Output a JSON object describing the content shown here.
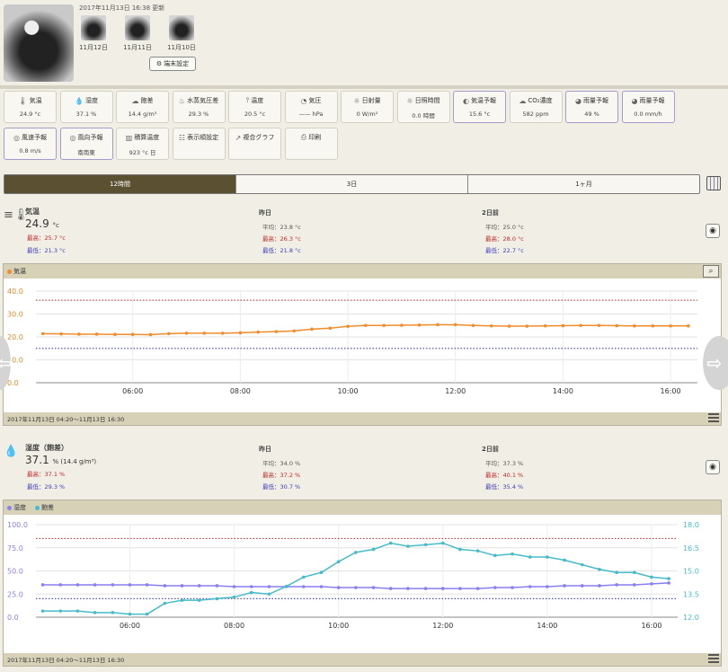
{
  "header": {
    "updated": "2017年11月13日 16:38 更新",
    "thumbs": [
      {
        "date": "11月12日"
      },
      {
        "date": "11月11日"
      },
      {
        "date": "11月10日"
      }
    ],
    "terminal_settings": "端末設定"
  },
  "tiles": [
    {
      "title": "気温",
      "value": "24.9 °c",
      "icon": "thermometer-icon",
      "purple": false
    },
    {
      "title": "湿度",
      "value": "37.1 %",
      "icon": "droplets-icon",
      "purple": false
    },
    {
      "title": "飽差",
      "value": "14.4 g/m³",
      "icon": "cloud-icon",
      "purple": false
    },
    {
      "title": "水蒸気圧差",
      "value": "29.3 %",
      "icon": "vapor-icon",
      "purple": false
    },
    {
      "title": "温度",
      "value": "20.5 °c",
      "icon": "soil-temp-icon",
      "purple": false
    },
    {
      "title": "気圧",
      "value": "—— hPa",
      "icon": "gauge-icon",
      "purple": false
    },
    {
      "title": "日射量",
      "value": "0 W/m²",
      "icon": "sun-icon",
      "purple": false
    },
    {
      "title": "日照時間",
      "value": "0.0 時間",
      "icon": "sun-time-icon",
      "purple": false
    },
    {
      "title": "気温予報",
      "value": "15.6 °c",
      "icon": "forecast-temp-icon",
      "purple": true
    },
    {
      "title": "CO₂濃度",
      "value": "582 ppm",
      "icon": "co2-icon",
      "purple": false
    },
    {
      "title": "雨量予報",
      "value": "49 %",
      "icon": "rain-icon",
      "purple": true
    },
    {
      "title": "雨量予報",
      "value": "0.0 mm/h",
      "icon": "rain-amount-icon",
      "purple": true
    },
    {
      "title": "風速予報",
      "value": "0.8 m/s",
      "icon": "wind-icon",
      "purple": true
    },
    {
      "title": "風向予報",
      "value": "南南東",
      "icon": "wind-direction-icon",
      "purple": true
    },
    {
      "title": "積算温度",
      "value": "923 °c 日",
      "icon": "accumulated-temp-icon",
      "purple": false
    },
    {
      "title": "表示順設定",
      "value": "",
      "icon": "order-settings-icon",
      "purple": false
    },
    {
      "title": "複合グラフ",
      "value": "",
      "icon": "composite-graph-icon",
      "purple": false
    },
    {
      "title": "印刷",
      "value": "",
      "icon": "print-icon",
      "purple": false
    }
  ],
  "tabs": [
    "12時間",
    "3日",
    "1ヶ月"
  ],
  "temp": {
    "name": "気温",
    "main": "24.9",
    "unit": "°c",
    "today_max": "最高：25.7 °c",
    "today_min": "最低：21.3 °c",
    "yesterday_label": "昨日",
    "y_avg": "平均：23.8 °c",
    "y_max": "最高：26.3 °c",
    "y_min": "最低：21.8 °c",
    "two_days_label": "2日前",
    "d2_avg": "平均：25.0 °c",
    "d2_max": "最高：28.0 °c",
    "d2_min": "最低：22.7 °c",
    "legend": "気温",
    "footer": "2017年11月13日 04:20～11月13日 16:30"
  },
  "humid": {
    "name": "湿度（飽差）",
    "main": "37.1",
    "unit": "% (14.4 g/m³)",
    "today_max": "最高：37.1 %",
    "today_min": "最低：29.3 %",
    "yesterday_label": "昨日",
    "y_avg": "平均：34.0 %",
    "y_max": "最高：37.2 %",
    "y_min": "最低：30.7 %",
    "two_days_label": "2日前",
    "d2_avg": "平均：37.3 %",
    "d2_max": "最高：40.1 %",
    "d2_min": "最低：35.4 %",
    "legend1": "湿度",
    "legend2": "飽差",
    "footer": "2017年11月13日 04:20～11月13日 16:30"
  },
  "chart_data": [
    {
      "type": "line",
      "title": "気温",
      "x": [
        4.33,
        4.67,
        5.0,
        5.33,
        5.67,
        6.0,
        6.33,
        6.67,
        7.0,
        7.33,
        7.67,
        8.0,
        8.33,
        8.67,
        9.0,
        9.33,
        9.67,
        10.0,
        10.33,
        10.67,
        11.0,
        11.33,
        11.67,
        12.0,
        12.33,
        12.67,
        13.0,
        13.33,
        13.67,
        14.0,
        14.33,
        14.67,
        15.0,
        15.33,
        15.67,
        16.0,
        16.33
      ],
      "series": [
        {
          "name": "気温",
          "color": "#f08c2c",
          "values": [
            21.4,
            21.3,
            21.2,
            21.2,
            21.1,
            21.1,
            21.0,
            21.4,
            21.6,
            21.6,
            21.6,
            21.8,
            22.1,
            22.3,
            22.6,
            23.4,
            23.8,
            24.6,
            25.0,
            25.0,
            25.1,
            25.2,
            25.3,
            25.3,
            25.0,
            24.8,
            24.7,
            24.7,
            24.8,
            24.9,
            25.0,
            25.0,
            24.9,
            24.8,
            24.8,
            24.8,
            24.8
          ]
        }
      ],
      "xticks": [
        "06:00",
        "08:00",
        "10:00",
        "12:00",
        "14:00",
        "16:00"
      ],
      "xtick_values": [
        6,
        8,
        10,
        12,
        14,
        16
      ],
      "yticks": [
        "0.0",
        "10.0",
        "20.0",
        "30.0",
        "40.0"
      ],
      "ylim": [
        0,
        40
      ],
      "thresholds": [
        {
          "value": 36,
          "color": "#e03030"
        },
        {
          "value": 15,
          "color": "#5050e0"
        }
      ],
      "grid": true
    },
    {
      "type": "line",
      "x": [
        4.33,
        4.67,
        5.0,
        5.33,
        5.67,
        6.0,
        6.33,
        6.67,
        7.0,
        7.33,
        7.67,
        8.0,
        8.33,
        8.67,
        9.0,
        9.33,
        9.67,
        10.0,
        10.33,
        10.67,
        11.0,
        11.33,
        11.67,
        12.0,
        12.33,
        12.67,
        13.0,
        13.33,
        13.67,
        14.0,
        14.33,
        14.67,
        15.0,
        15.33,
        15.67,
        16.0,
        16.33
      ],
      "series": [
        {
          "name": "湿度",
          "axis": "left",
          "color": "#8a7ff0",
          "values": [
            35,
            35,
            35,
            35,
            35,
            35,
            35,
            34,
            34,
            34,
            34,
            33,
            33,
            33,
            33,
            33,
            33,
            32,
            32,
            32,
            31,
            31,
            31,
            31,
            31,
            31,
            32,
            32,
            33,
            33,
            34,
            34,
            34,
            35,
            35,
            36,
            37
          ]
        },
        {
          "name": "飽差",
          "axis": "right",
          "color": "#46bcc8",
          "values": [
            12.4,
            12.4,
            12.4,
            12.3,
            12.3,
            12.2,
            12.2,
            12.9,
            13.1,
            13.1,
            13.2,
            13.3,
            13.6,
            13.5,
            14.0,
            14.6,
            14.9,
            15.6,
            16.2,
            16.4,
            16.8,
            16.6,
            16.7,
            16.8,
            16.4,
            16.3,
            16.0,
            16.1,
            15.9,
            15.9,
            15.7,
            15.4,
            15.1,
            14.9,
            14.9,
            14.6,
            14.5
          ]
        }
      ],
      "xticks": [
        "06:00",
        "08:00",
        "10:00",
        "12:00",
        "14:00",
        "16:00"
      ],
      "xtick_values": [
        6,
        8,
        10,
        12,
        14,
        16
      ],
      "yticks": [
        "0.0",
        "25.0",
        "50.0",
        "75.0",
        "100.0"
      ],
      "ylim": [
        0,
        100
      ],
      "y2ticks": [
        "12.0",
        "13.5",
        "15.0",
        "16.5",
        "18.0"
      ],
      "y2lim": [
        12,
        18
      ],
      "thresholds": [
        {
          "value": 85,
          "color": "#e03030"
        },
        {
          "value": 20,
          "color": "#5050e0"
        }
      ],
      "grid": true
    }
  ]
}
